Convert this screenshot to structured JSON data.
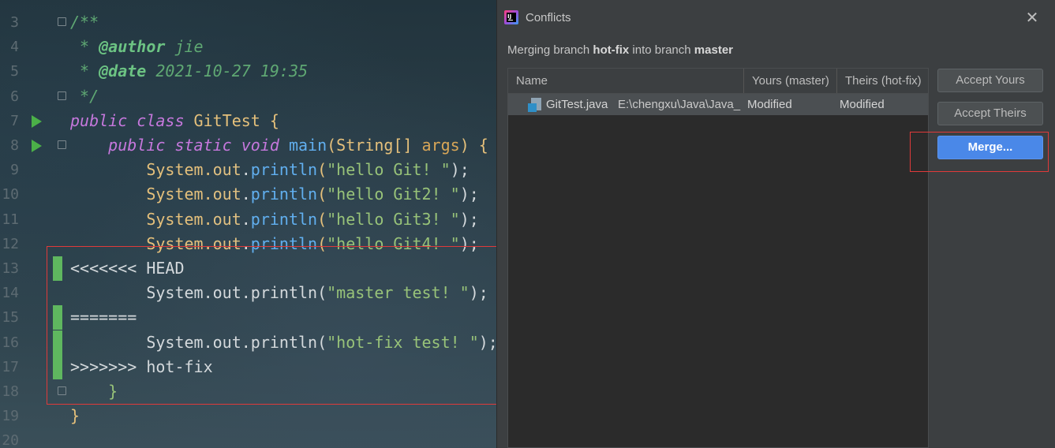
{
  "editor": {
    "lines": [
      {
        "num": "3",
        "tokens": [
          {
            "t": "/**",
            "c": "tk-comment"
          }
        ]
      },
      {
        "num": "4",
        "tokens": [
          {
            "t": " * ",
            "c": "tk-comment"
          },
          {
            "t": "@author",
            "c": "tk-tag"
          },
          {
            "t": " jie",
            "c": "tk-comment"
          }
        ]
      },
      {
        "num": "5",
        "tokens": [
          {
            "t": " * ",
            "c": "tk-comment"
          },
          {
            "t": "@date",
            "c": "tk-tag"
          },
          {
            "t": " 2021-10-27 19:35",
            "c": "tk-comment"
          }
        ]
      },
      {
        "num": "6",
        "tokens": [
          {
            "t": " */",
            "c": "tk-comment"
          }
        ]
      },
      {
        "num": "7",
        "tokens": [
          {
            "t": "public class ",
            "c": "tk-kw"
          },
          {
            "t": "GitTest ",
            "c": "tk-cls"
          },
          {
            "t": "{",
            "c": "tk-brace"
          }
        ]
      },
      {
        "num": "8",
        "tokens": [
          {
            "t": "    public static void ",
            "c": "tk-kw"
          },
          {
            "t": "main",
            "c": "tk-fn"
          },
          {
            "t": "(String[] ",
            "c": "tk-cls"
          },
          {
            "t": "args",
            "c": "tk-param"
          },
          {
            "t": ") {",
            "c": "tk-cls"
          }
        ]
      },
      {
        "num": "9",
        "tokens": [
          {
            "t": "        System.",
            "c": "tk-cls"
          },
          {
            "t": "out",
            "c": "tk-field"
          },
          {
            "t": ".",
            "c": "tk-plain"
          },
          {
            "t": "println",
            "c": "tk-fn"
          },
          {
            "t": "(",
            "c": "tk-cls"
          },
          {
            "t": "\"hello Git! \"",
            "c": "tk-str"
          },
          {
            "t": ");",
            "c": "tk-plain"
          }
        ]
      },
      {
        "num": "10",
        "tokens": [
          {
            "t": "        System.",
            "c": "tk-cls"
          },
          {
            "t": "out",
            "c": "tk-field"
          },
          {
            "t": ".",
            "c": "tk-plain"
          },
          {
            "t": "println",
            "c": "tk-fn"
          },
          {
            "t": "(",
            "c": "tk-cls"
          },
          {
            "t": "\"hello Git2! \"",
            "c": "tk-str"
          },
          {
            "t": ");",
            "c": "tk-plain"
          }
        ]
      },
      {
        "num": "11",
        "tokens": [
          {
            "t": "        System.",
            "c": "tk-cls"
          },
          {
            "t": "out",
            "c": "tk-field"
          },
          {
            "t": ".",
            "c": "tk-plain"
          },
          {
            "t": "println",
            "c": "tk-fn"
          },
          {
            "t": "(",
            "c": "tk-cls"
          },
          {
            "t": "\"hello Git3! \"",
            "c": "tk-str"
          },
          {
            "t": ");",
            "c": "tk-plain"
          }
        ]
      },
      {
        "num": "12",
        "tokens": [
          {
            "t": "        System.",
            "c": "tk-cls"
          },
          {
            "t": "out",
            "c": "tk-field"
          },
          {
            "t": ".",
            "c": "tk-plain"
          },
          {
            "t": "println",
            "c": "tk-fn"
          },
          {
            "t": "(",
            "c": "tk-cls"
          },
          {
            "t": "\"hello Git4! \"",
            "c": "tk-str"
          },
          {
            "t": ");",
            "c": "tk-plain"
          }
        ]
      },
      {
        "num": "13",
        "tokens": [
          {
            "t": "<<<<<<< HEAD",
            "c": "tk-plain"
          }
        ]
      },
      {
        "num": "14",
        "tokens": [
          {
            "t": "        System.out.println(",
            "c": "tk-plain"
          },
          {
            "t": "\"master test! \"",
            "c": "tk-str"
          },
          {
            "t": ");",
            "c": "tk-plain"
          }
        ]
      },
      {
        "num": "15",
        "tokens": [
          {
            "t": "=======",
            "c": "tk-plain"
          }
        ]
      },
      {
        "num": "16",
        "tokens": [
          {
            "t": "        System.out.println(",
            "c": "tk-plain"
          },
          {
            "t": "\"hot-fix test! \"",
            "c": "tk-str"
          },
          {
            "t": ");",
            "c": "tk-plain"
          }
        ]
      },
      {
        "num": "17",
        "tokens": [
          {
            "t": ">>>>>>> hot-fix",
            "c": "tk-plain"
          }
        ]
      },
      {
        "num": "18",
        "tokens": [
          {
            "t": "    }",
            "c": "tk-str"
          }
        ]
      },
      {
        "num": "19",
        "tokens": [
          {
            "t": "}",
            "c": "tk-brace"
          }
        ]
      },
      {
        "num": "20",
        "tokens": []
      }
    ]
  },
  "dialog": {
    "title": "Conflicts",
    "app_icon_text": "IJ",
    "close_glyph": "✕",
    "description": {
      "prefix": "Merging branch ",
      "source_branch": "hot-fix",
      "middle": " into branch ",
      "target_branch": "master"
    },
    "table": {
      "headers": [
        "Name",
        "Yours (master)",
        "Theirs (hot-fix)"
      ],
      "rows": [
        {
          "file": "GitTest.java",
          "path": "E:\\chengxu\\Java\\Java_",
          "yours": "Modified",
          "theirs": "Modified",
          "icon": "java-file-icon"
        }
      ]
    },
    "buttons": {
      "accept_yours": "Accept Yours",
      "accept_theirs": "Accept Theirs",
      "merge": "Merge..."
    }
  },
  "colors": {
    "accent": "#4a88e8",
    "conflict_marker": "#5fb75f",
    "annotation_red": "#e03a3a"
  }
}
